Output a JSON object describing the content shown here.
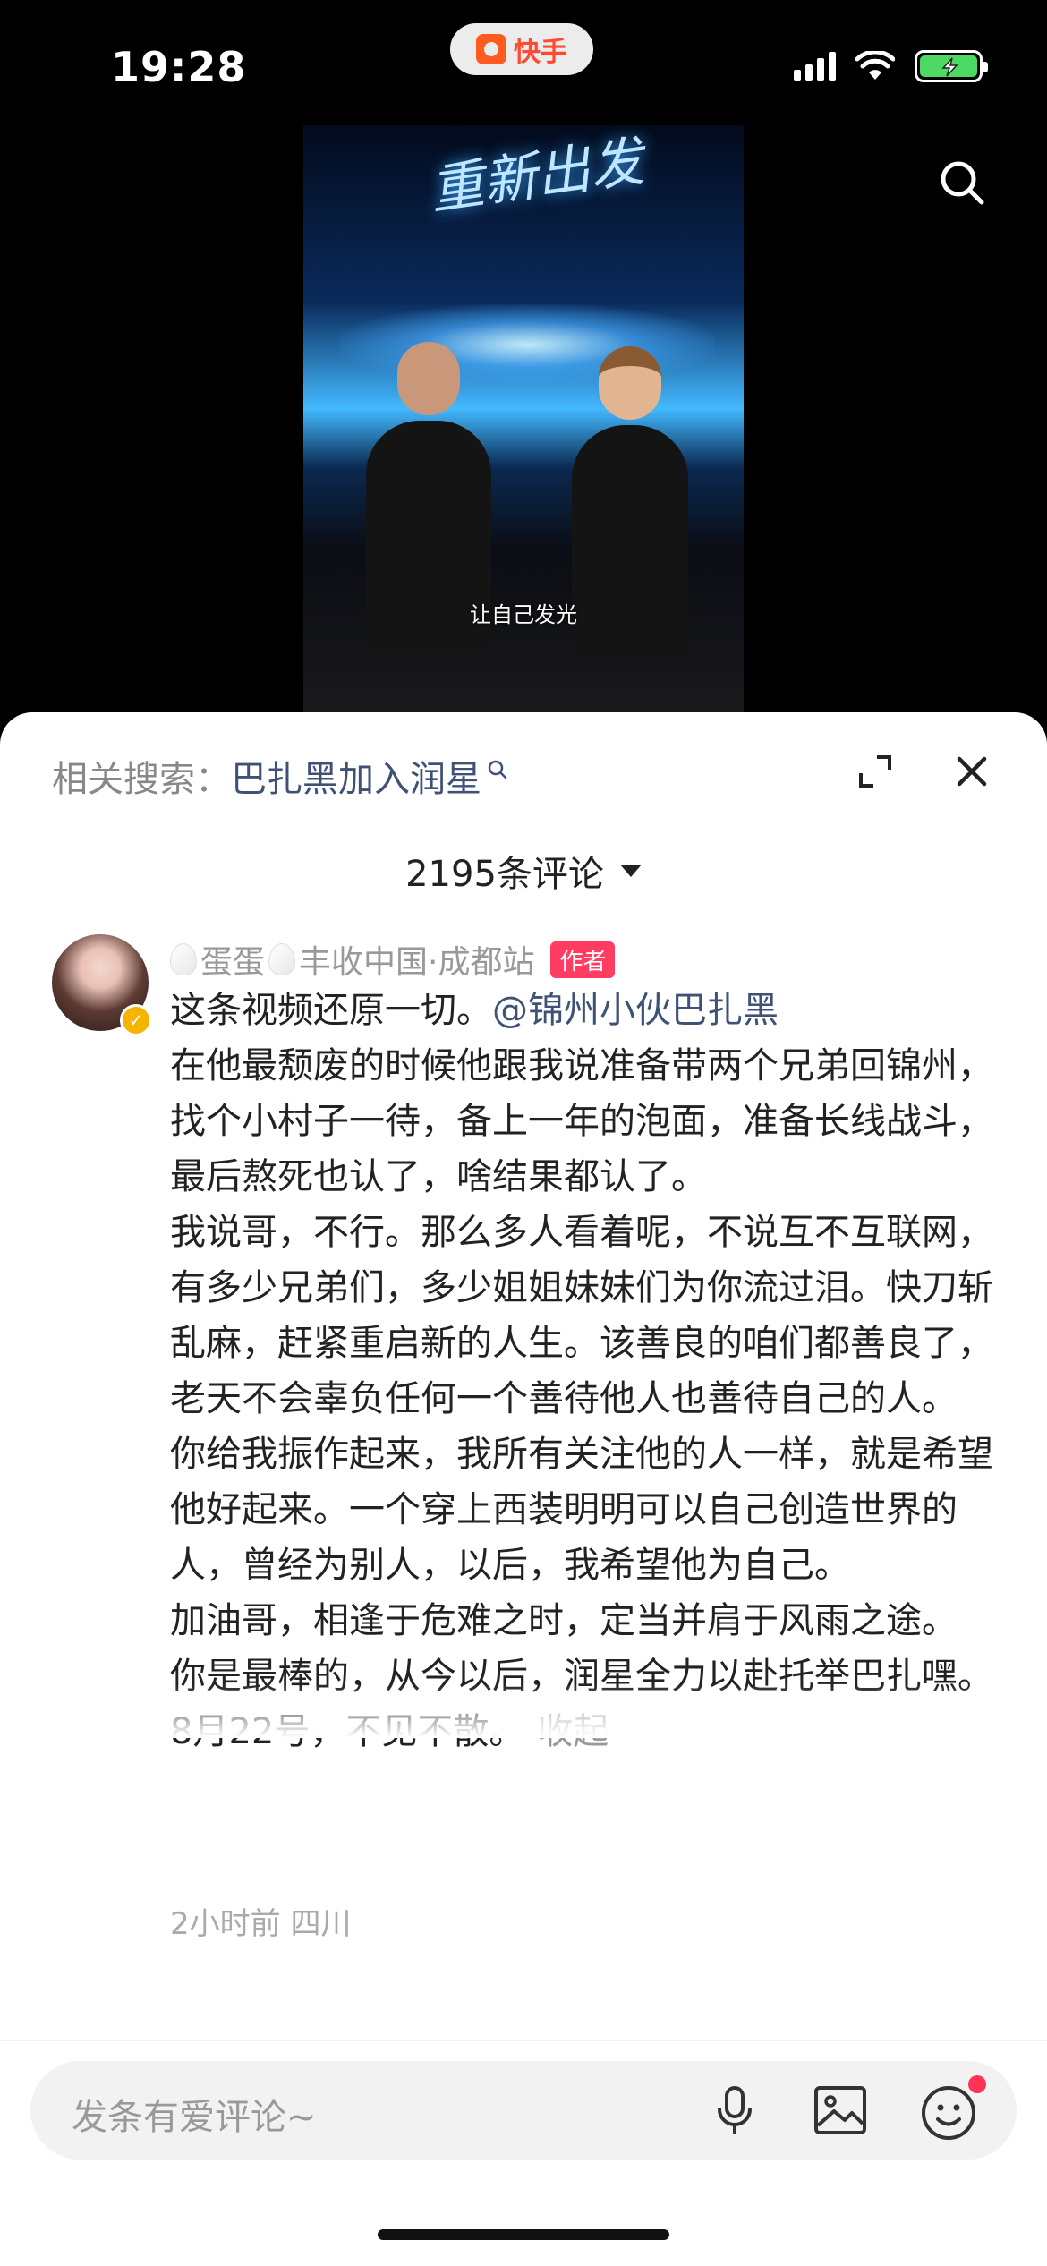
{
  "status_bar": {
    "time": "19:28",
    "app_name": "快手",
    "icons": [
      "signal-icon",
      "wifi-icon",
      "battery-charging-icon"
    ]
  },
  "video": {
    "title_overlay": "重新出发",
    "subtitle": "让自己发光"
  },
  "sheet": {
    "related_label": "相关搜索：",
    "related_term": "巴扎黑加入润星",
    "comment_count": "2195条评论"
  },
  "comment": {
    "nickname": "丰收中国·成都站",
    "nickname_prefix": "蛋蛋",
    "author_badge": "作者",
    "body_first": "这条视频还原一切。",
    "mention": "@锦州小伙巴扎黑",
    "paragraphs": [
      "在他最颓废的时候他跟我说准备带两个兄弟回锦州，找个小村子一待，备上一年的泡面，准备长线战斗，最后熬死也认了，啥结果都认了。",
      "我说哥，不行。那么多人看着呢，不说互不互联网，有多少兄弟们，多少姐姐妹妹们为你流过泪。快刀斩乱麻，赶紧重启新的人生。该善良的咱们都善良了，老天不会辜负任何一个善待他人也善待自己的人。",
      "你给我振作起来，我所有关注他的人一样，就是希望他好起来。一个穿上西装明明可以自己创造世界的人，曾经为别人，以后，我希望他为自己。",
      "加油哥，相逢于危难之时，定当并肩于风雨之途。",
      "你是最棒的，从今以后，润星全力以赴托举巴扎嘿。"
    ],
    "last_line": "8月22号，不见不散。",
    "collapse_label": "收起",
    "meta": "2小时前 四川"
  },
  "input": {
    "placeholder": "发条有爱评论~"
  },
  "colors": {
    "accent_link": "#3f5276",
    "author_badge": "#ff3d62",
    "battery": "#4cd964"
  }
}
